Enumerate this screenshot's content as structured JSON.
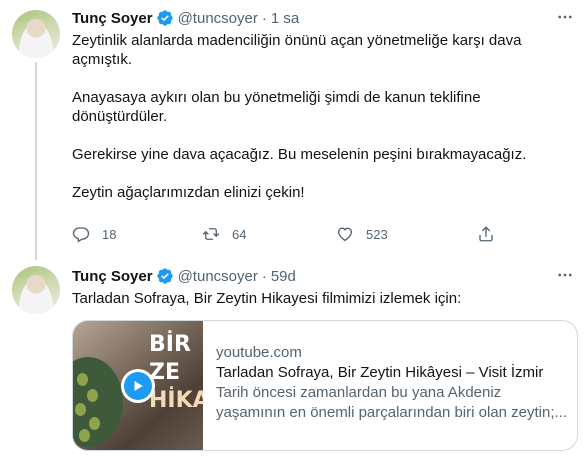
{
  "tweets": [
    {
      "display_name": "Tunç Soyer",
      "handle": "@tuncsoyer",
      "separator": "·",
      "time": "1 sa",
      "text": "Zeytinlik alanlarda madenciliğin önünü açan yönetmeliğe karşı dava açmıştık.\n\nAnayasaya aykırı olan bu yönetmeliği şimdi de kanun teklifine dönüştürdüler.\n\nGerekirse yine dava açacağız. Bu meselenin peşini bırakmayacağız.\n\nZeytin ağaçlarımızdan elinizi çekin!",
      "actions": {
        "replies": "18",
        "retweets": "64",
        "likes": "523"
      }
    },
    {
      "display_name": "Tunç Soyer",
      "handle": "@tuncsoyer",
      "separator": "·",
      "time": "59d",
      "text": "Tarladan Sofraya, Bir Zeytin Hikayesi filmimizi izlemek için:",
      "card": {
        "thumbnail_text_line1": "BİR ZE",
        "thumbnail_text_line2": "HİKA",
        "domain": "youtube.com",
        "title": "Tarladan Sofraya, Bir Zeytin Hikâyesi – Visit İzmir",
        "description_line1": "Tarih öncesi zamanlardan bu yana Akdeniz",
        "description_line2": "yaşamının en önemli parçalarından biri olan zeytin;..."
      }
    }
  ],
  "icons": {
    "verified": "verified-badge-icon",
    "more": "more-dots-icon",
    "reply": "reply-icon",
    "retweet": "retweet-icon",
    "like": "heart-icon",
    "share": "share-icon",
    "play": "play-icon"
  },
  "colors": {
    "accent": "#1d9bf0",
    "text_primary": "#0f1419",
    "text_secondary": "#536471",
    "border": "#cfd9de"
  }
}
